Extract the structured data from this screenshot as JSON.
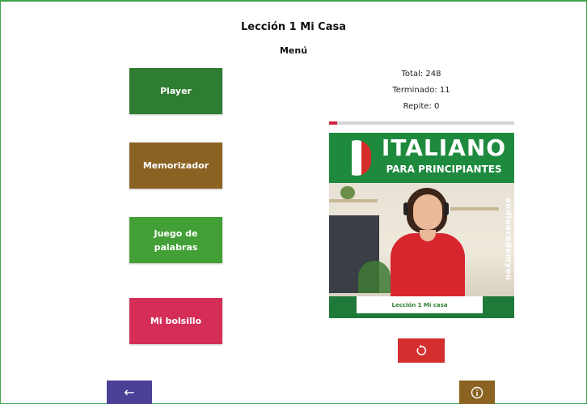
{
  "header": {
    "title": "Lección 1 Mi Casa",
    "subtitle": "Menú"
  },
  "menu": {
    "player": "Player",
    "memorizador": "Memorizador",
    "juego": "Juego de palabras",
    "bolsillo": "Mi bolsillo"
  },
  "stats": {
    "total": "Total: 248",
    "terminado": "Terminado: 11",
    "repite": "Repite: 0"
  },
  "progress": {
    "completed": 11,
    "total": 248,
    "fraction": 0.044
  },
  "cover": {
    "title": "ITALIANO",
    "subtitle": "PARA PRINCIPIANTES",
    "brand": "audioacademyeu",
    "label": "Lección 1 Mi casa"
  },
  "icons": {
    "reset": "refresh-icon",
    "back": "arrow-left-icon",
    "info": "info-icon"
  },
  "colors": {
    "player": "#2e7d32",
    "memorizador": "#8a6222",
    "juego": "#43a036",
    "bolsillo": "#d42e58",
    "reset": "#d42e2e",
    "back": "#4a4196",
    "info": "#8a6222",
    "progress_fill": "#d0243e"
  }
}
